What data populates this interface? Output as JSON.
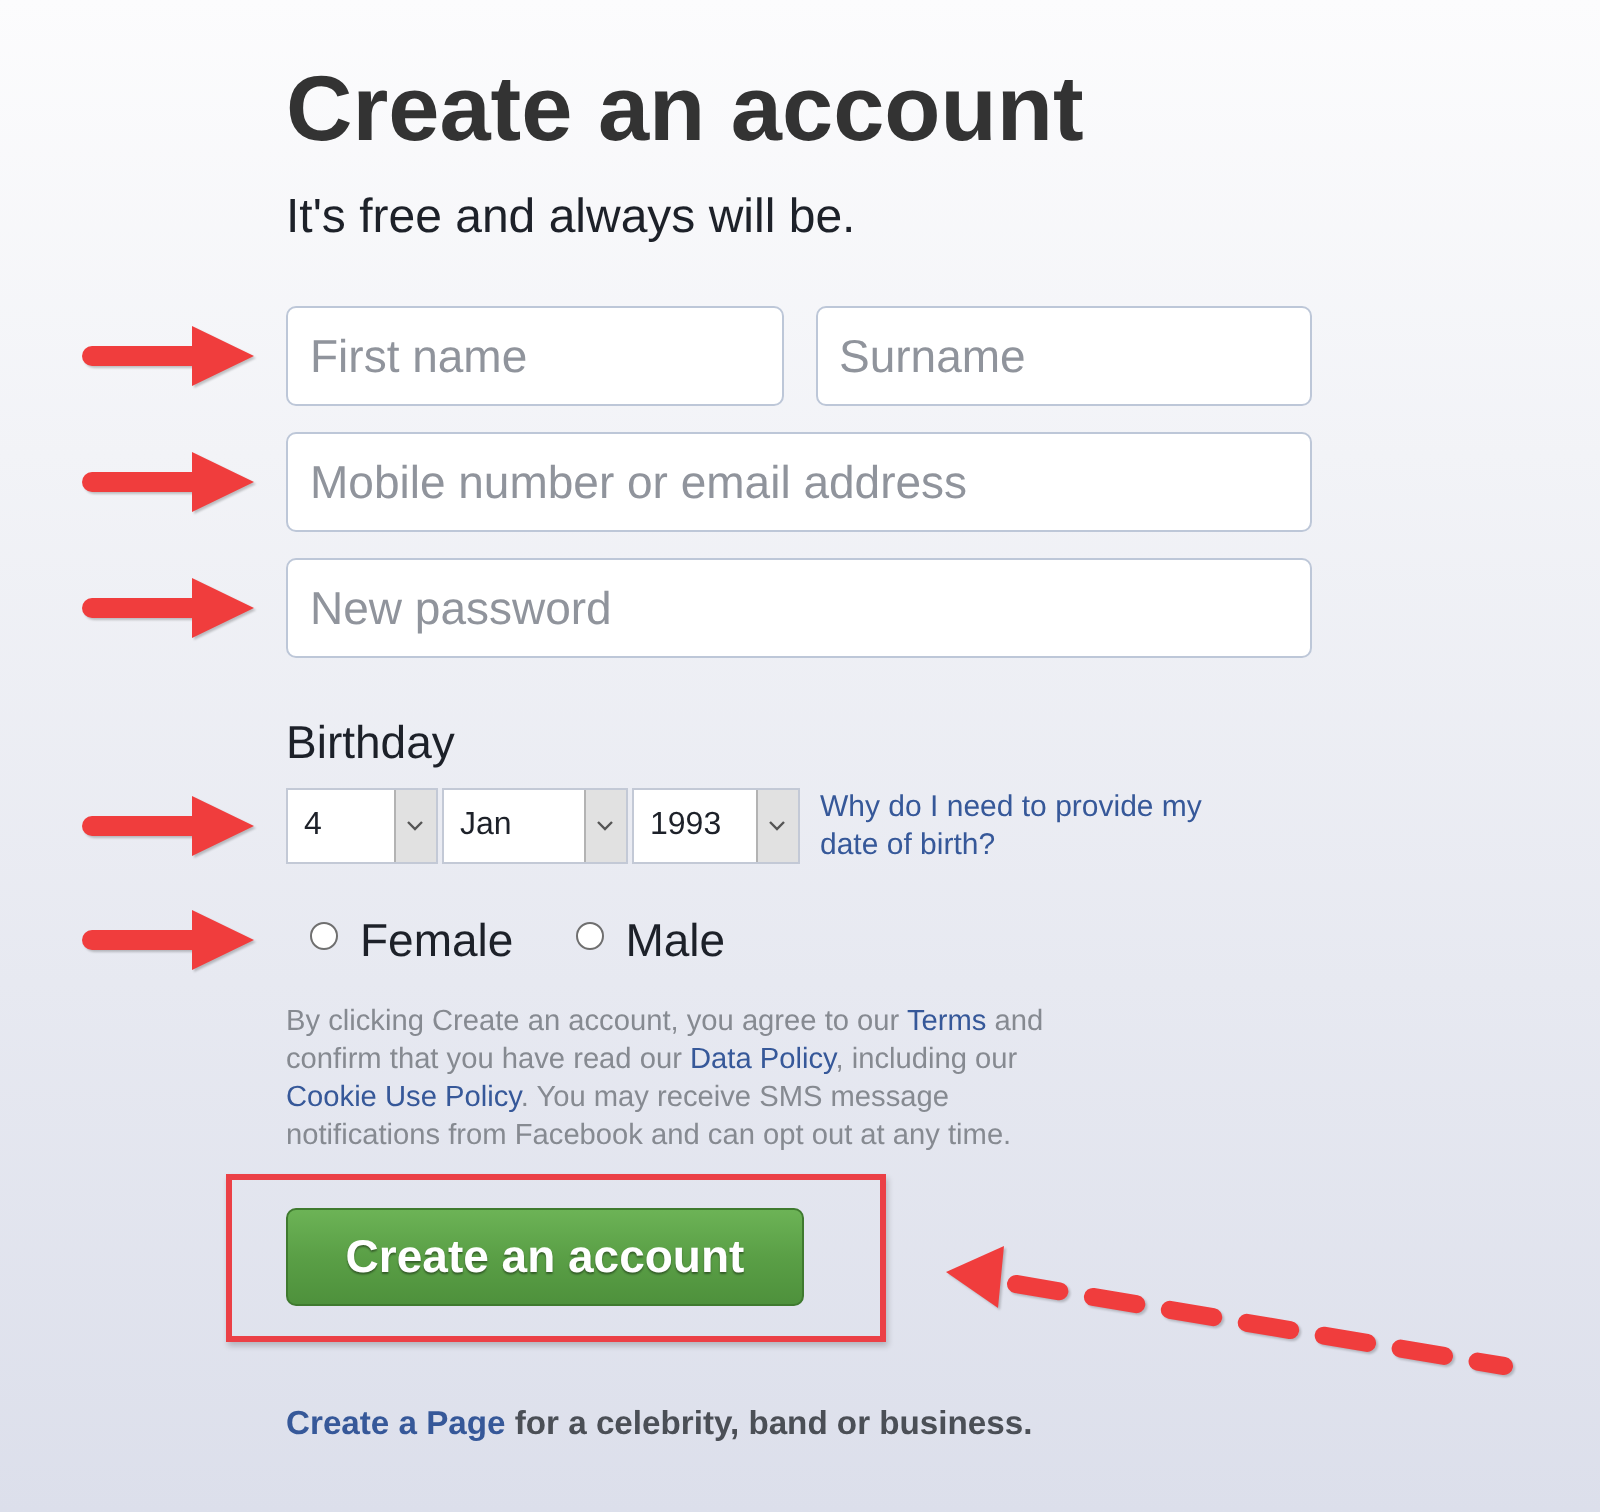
{
  "heading": "Create an account",
  "subtitle": "It's free and always will be.",
  "form_rows": [
    {
      "annotated": true,
      "fields": [
        {
          "placeholder": "First name"
        },
        {
          "placeholder": "Surname"
        }
      ]
    },
    {
      "annotated": true,
      "fields": [
        {
          "placeholder": "Mobile number or email address"
        }
      ]
    },
    {
      "annotated": true,
      "fields": [
        {
          "placeholder": "New password"
        }
      ]
    }
  ],
  "birthday": {
    "label": "Birthday",
    "annotated": true,
    "selects": [
      {
        "value": "4"
      },
      {
        "value": "Jan"
      },
      {
        "value": "1993"
      }
    ],
    "help_link": "Why do I need to provide my date of birth?"
  },
  "gender": {
    "annotated": true,
    "options": [
      {
        "label": "Female",
        "selected": false
      },
      {
        "label": "Male",
        "selected": false
      }
    ]
  },
  "terms": [
    {
      "kind": "text",
      "text": "By clicking Create an account, you agree to our "
    },
    {
      "kind": "link",
      "text": "Terms"
    },
    {
      "kind": "text",
      "text": " and confirm that you have read our "
    },
    {
      "kind": "link",
      "text": "Data Policy"
    },
    {
      "kind": "text",
      "text": ", including our "
    },
    {
      "kind": "link",
      "text": "Cookie Use Policy"
    },
    {
      "kind": "text",
      "text": ". You may receive SMS message notifications from Facebook and can opt out at any time."
    }
  ],
  "submit_button": {
    "label": "Create an account",
    "highlighted": true
  },
  "footer": [
    {
      "kind": "link",
      "text": "Create a Page"
    },
    {
      "kind": "text",
      "text": " for a celebrity, band or business."
    }
  ]
}
